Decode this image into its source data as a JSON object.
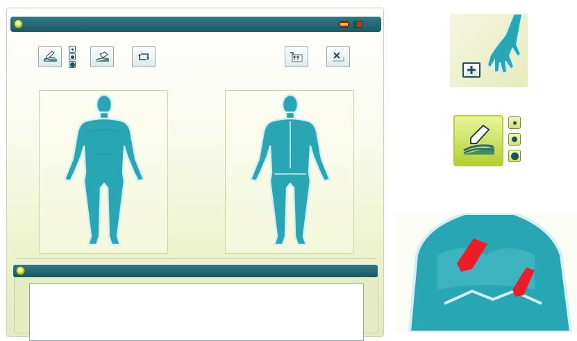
{
  "app": {
    "flags": [
      {
        "name": "flag-spain",
        "colors": [
          "#c60b1e",
          "#ffc400"
        ]
      },
      {
        "name": "flag-portugal",
        "colors": [
          "#046a38",
          "#da291c"
        ]
      }
    ]
  },
  "toolbar": {
    "left_tools": [
      "draw-pencil-icon",
      "erase-icon",
      "rotate-view-icon"
    ],
    "brush_sizes": [
      "small",
      "medium",
      "large"
    ],
    "right_tools": [
      "transfer-icon",
      "clear-icon"
    ],
    "rotate_glyph": "⤴"
  },
  "figures": [
    {
      "name": "body-front-view",
      "color": "#29a6b3"
    },
    {
      "name": "body-back-view",
      "color": "#29a6b3"
    }
  ],
  "notes": {
    "value": ""
  },
  "theme": {
    "header": "#1f6673",
    "accent": "#b3cf1d",
    "body_fill": "#29a6b3",
    "marking": "#ee1c24"
  }
}
